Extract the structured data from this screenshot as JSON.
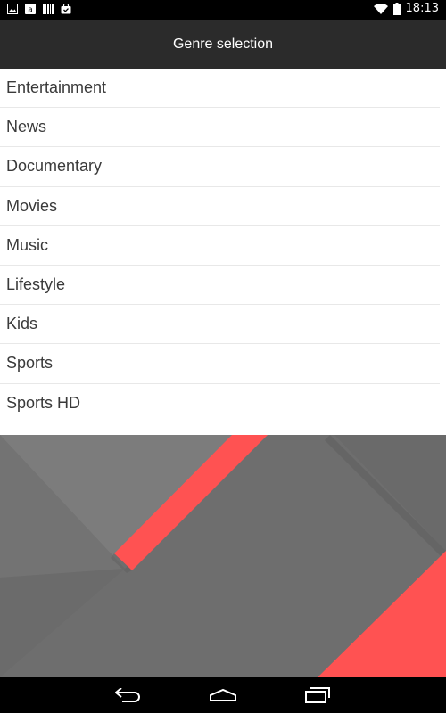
{
  "status_bar": {
    "time": "18:13",
    "left_icons": [
      "image-icon",
      "amazon-icon",
      "barcode-icon",
      "shopping-bag-icon"
    ],
    "right_icons": [
      "wifi-icon",
      "battery-icon"
    ]
  },
  "app_bar": {
    "title": "Genre selection"
  },
  "genres": [
    {
      "label": "Entertainment"
    },
    {
      "label": "News"
    },
    {
      "label": "Documentary"
    },
    {
      "label": "Movies"
    },
    {
      "label": "Music"
    },
    {
      "label": "Lifestyle"
    },
    {
      "label": "Kids"
    },
    {
      "label": "Sports"
    },
    {
      "label": "Sports HD"
    }
  ],
  "nav_bar": {
    "buttons": [
      "back-icon",
      "home-icon",
      "recents-icon"
    ]
  },
  "colors": {
    "accent": "#ff5252",
    "app_bar": "#2b2b2b",
    "wallpaper_gray": "#6e6e6e"
  }
}
